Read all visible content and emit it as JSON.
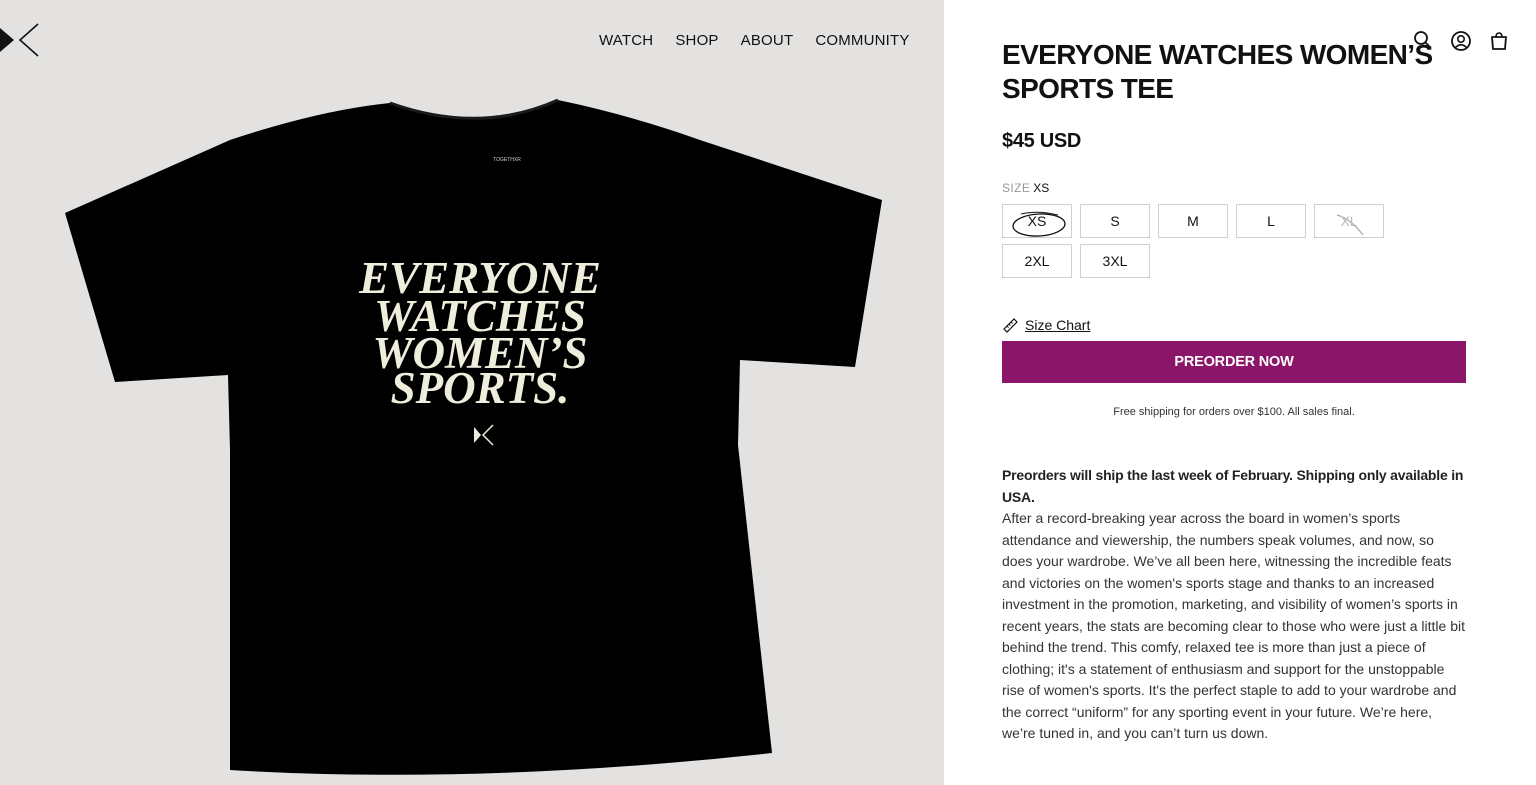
{
  "nav": {
    "items": [
      "WATCH",
      "SHOP",
      "ABOUT",
      "COMMUNITY"
    ]
  },
  "product": {
    "title": "EVERYONE WATCHES WOMEN’S SPORTS TEE",
    "price": "$45 USD",
    "size_label": "SIZE",
    "selected_size": "XS",
    "sizes": [
      {
        "label": "XS",
        "state": "selected"
      },
      {
        "label": "S",
        "state": "available"
      },
      {
        "label": "M",
        "state": "available"
      },
      {
        "label": "L",
        "state": "available"
      },
      {
        "label": "XL",
        "state": "sold-out"
      },
      {
        "label": "2XL",
        "state": "available"
      },
      {
        "label": "3XL",
        "state": "available"
      }
    ],
    "size_chart_label": "Size Chart",
    "preorder_label": "PREORDER NOW",
    "shipping_note": "Free shipping for orders over $100. All sales final.",
    "description_lead": "Preorders will ship the last week of February. Shipping only available in USA.",
    "description_body": "After a record-breaking year across the board in women’s sports attendance and viewership, the numbers speak volumes, and now, so does your wardrobe. We’ve all been here, witnessing the incredible feats and victories on the women's sports stage and thanks to an increased investment in the promotion, marketing, and visibility of women’s sports in recent years, the stats are becoming clear to those who were just a little bit behind the trend. This comfy, relaxed tee is more than just a piece of clothing; it's a statement of enthusiasm and support for the unstoppable rise of women's sports. It's the perfect staple to add to your wardrobe and the correct “uniform” for any sporting event in your future. We’re here, we’re tuned in, and you can’t turn us down."
  },
  "shirt": {
    "print_lines": [
      "EVERYONE",
      "WATCHES",
      "WOMEN’S",
      "SPORTS."
    ],
    "neck_label": "TOGETHXR"
  },
  "colors": {
    "brand": "#8b1568",
    "image_bg": "#e3e2e1",
    "shirt": "#000000",
    "print": "#efeedd"
  },
  "icons": [
    "brand-logo-icon",
    "search-icon",
    "account-icon",
    "bag-icon",
    "ruler-icon"
  ]
}
